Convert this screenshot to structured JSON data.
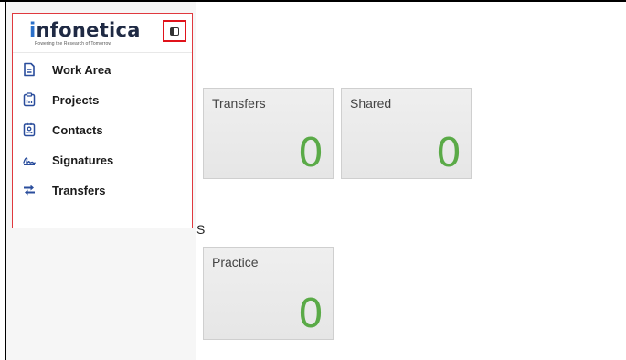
{
  "brand": {
    "logo_prefix": "i",
    "logo_rest": "nfonetica",
    "tagline": "Powering the Research of Tomorrow"
  },
  "sidebar": {
    "toggle_icon": "sidebar-toggle-icon",
    "items": [
      {
        "label": "Work Area",
        "icon": "document-icon"
      },
      {
        "label": "Projects",
        "icon": "clipboard-icon"
      },
      {
        "label": "Contacts",
        "icon": "contact-card-icon"
      },
      {
        "label": "Signatures",
        "icon": "signature-icon"
      },
      {
        "label": "Transfers",
        "icon": "transfer-arrows-icon"
      }
    ]
  },
  "main": {
    "tiles": [
      {
        "title": "Transfers",
        "count": "0"
      },
      {
        "title": "Shared",
        "count": "0"
      },
      {
        "title": "Practice",
        "count": "0"
      }
    ],
    "section_fragment": "S"
  },
  "colors": {
    "accent_green": "#5aaa47",
    "highlight_red": "#e0131b",
    "brand_blue": "#2a6fc9",
    "icon_navy": "#2a4d9c"
  }
}
